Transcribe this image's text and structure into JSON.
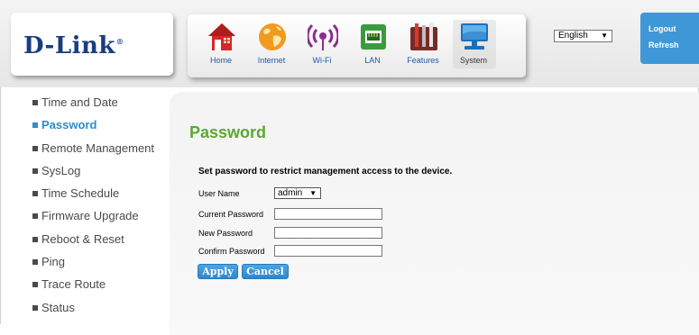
{
  "brand": {
    "logo": "D-Link",
    "registered": "®"
  },
  "nav": {
    "items": [
      {
        "label": "Home",
        "icon": "home-icon"
      },
      {
        "label": "Internet",
        "icon": "globe-icon"
      },
      {
        "label": "Wi-Fi",
        "icon": "wifi-icon"
      },
      {
        "label": "LAN",
        "icon": "lan-port-icon"
      },
      {
        "label": "Features",
        "icon": "tools-icon"
      },
      {
        "label": "System",
        "icon": "computer-icon"
      }
    ],
    "active": "System"
  },
  "language": {
    "selected": "English"
  },
  "session": {
    "logout": "Logout",
    "refresh": "Refresh"
  },
  "sidebar": {
    "items": [
      {
        "label": "Time and Date"
      },
      {
        "label": "Password"
      },
      {
        "label": "Remote Management"
      },
      {
        "label": "SysLog"
      },
      {
        "label": "Time Schedule"
      },
      {
        "label": "Firmware Upgrade"
      },
      {
        "label": "Reboot & Reset"
      },
      {
        "label": "Ping"
      },
      {
        "label": "Trace Route"
      },
      {
        "label": "Status"
      }
    ],
    "active": "Password"
  },
  "main": {
    "title": "Password",
    "description": "Set password to restrict management access to the device.",
    "form": {
      "user_name_label": "User Name",
      "user_name_value": "admin",
      "current_password_label": "Current Password",
      "new_password_label": "New Password",
      "confirm_password_label": "Confirm Password"
    },
    "buttons": {
      "apply": "Apply",
      "cancel": "Cancel"
    }
  },
  "colors": {
    "accent_blue": "#3f97d8",
    "title_green": "#5ba832",
    "logo_navy": "#1a3d7c",
    "active_link": "#2e8bd1"
  }
}
